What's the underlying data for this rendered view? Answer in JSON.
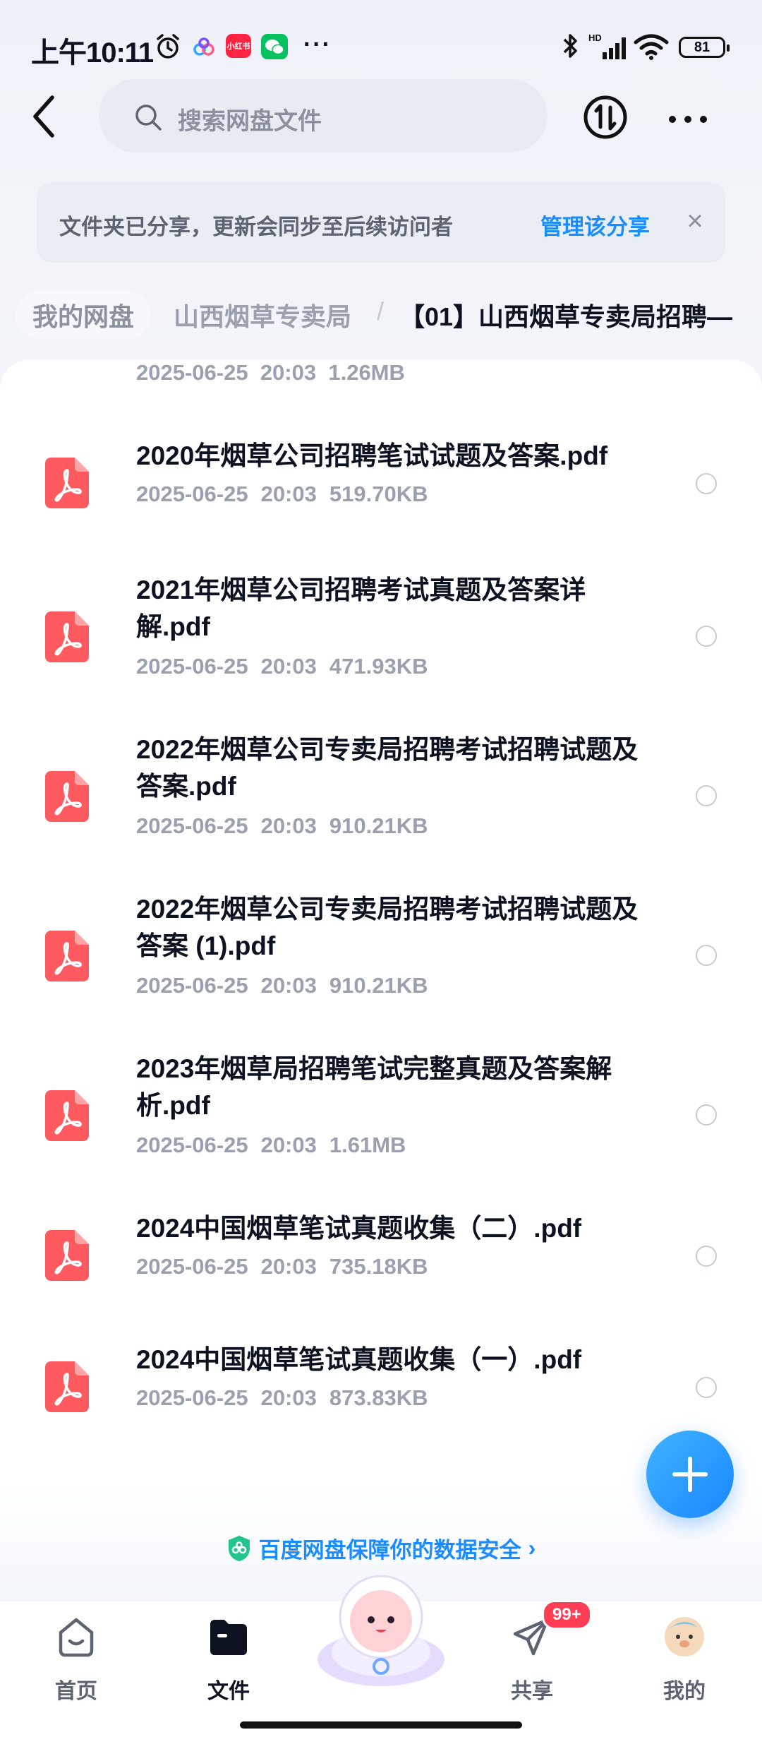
{
  "status_bar": {
    "time": "上午10:11",
    "apps": [
      {
        "name": "alarm-icon"
      },
      {
        "name": "baidu-netdisk-app-icon"
      },
      {
        "name": "xiaohongshu-app-icon",
        "label": "小红书",
        "color": "#ff2442"
      },
      {
        "name": "wechat-app-icon",
        "color": "#07c160"
      }
    ],
    "more": "···",
    "battery": "81"
  },
  "top_bar": {
    "search_placeholder": "搜索网盘文件"
  },
  "notice": {
    "text": "文件夹已分享，更新会同步至后续访问者",
    "link": "管理该分享",
    "close": "×"
  },
  "breadcrumb": {
    "root": "我的网盘",
    "parent": "山西烟草专卖局",
    "separator": "/",
    "current": "【01】山西烟草专卖局招聘—"
  },
  "files": {
    "partial_meta": {
      "date": "2025-06-25",
      "time": "20:03",
      "size": "1.26MB"
    },
    "items": [
      {
        "name": "2020年烟草公司招聘笔试试题及答案.pdf",
        "date": "2025-06-25",
        "time": "20:03",
        "size": "519.70KB"
      },
      {
        "name": "2021年烟草公司招聘考试真题及答案详解.pdf",
        "date": "2025-06-25",
        "time": "20:03",
        "size": "471.93KB"
      },
      {
        "name": "2022年烟草公司专卖局招聘考试招聘试题及答案.pdf",
        "date": "2025-06-25",
        "time": "20:03",
        "size": "910.21KB"
      },
      {
        "name": "2022年烟草公司专卖局招聘考试招聘试题及答案 (1).pdf",
        "date": "2025-06-25",
        "time": "20:03",
        "size": "910.21KB"
      },
      {
        "name": "2023年烟草局招聘笔试完整真题及答案解析.pdf",
        "date": "2025-06-25",
        "time": "20:03",
        "size": "1.61MB"
      },
      {
        "name": "2024中国烟草笔试真题收集（二）.pdf",
        "date": "2025-06-25",
        "time": "20:03",
        "size": "735.18KB"
      },
      {
        "name": "2024中国烟草笔试真题收集（一）.pdf",
        "date": "2025-06-25",
        "time": "20:03",
        "size": "873.83KB"
      }
    ]
  },
  "security_banner": {
    "text": "百度网盘保障你的数据安全",
    "chevron": "›"
  },
  "bottom_nav": {
    "home": "首页",
    "files": "文件",
    "share": "共享",
    "share_badge": "99+",
    "me": "我的"
  },
  "colors": {
    "accent": "#1a8cff",
    "pdf_red": "#ff5a5f",
    "badge_red": "#ff3d55"
  }
}
